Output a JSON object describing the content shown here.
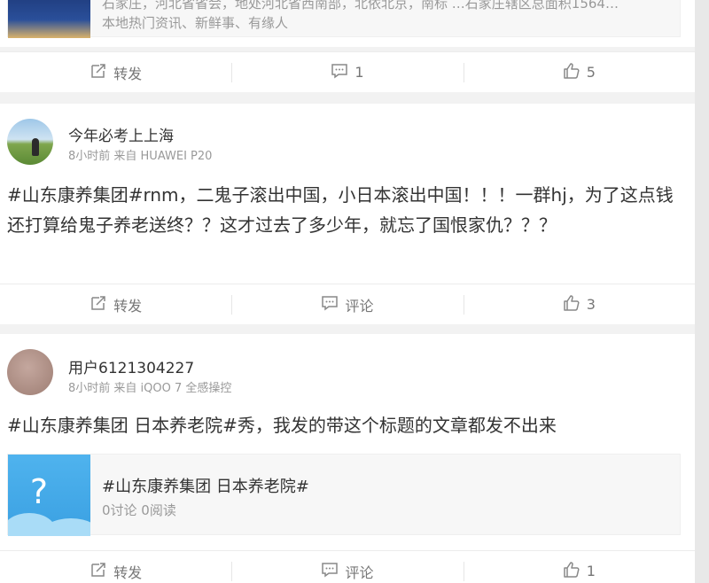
{
  "post0": {
    "excerpt": "石家庄，河北省省会，地处河北省西南部，北依北京，南标 …石家庄辖区总面积1564…",
    "subtitle": "本地热门资讯、新鲜事、有缘人",
    "repost": "转发",
    "comments": "1",
    "likes": "5"
  },
  "post1": {
    "username": "今年必考上上海",
    "meta": "8小时前  来自 HUAWEI P20",
    "text": "#山东康养集团#rnm，二鬼子滚出中国，小日本滚出中国！！！一群hj，为了这点钱还打算给鬼子养老送终？？这才过去了多少年，就忘了国恨家仇？？？",
    "repost": "转发",
    "comment": "评论",
    "likes": "3"
  },
  "post2": {
    "username": "用户6121304227",
    "meta": "8小时前  来自 iQOO 7 全感操控",
    "text": "#山东康养集团 日本养老院#秀，我发的带这个标题的文章都发不出来",
    "link_title": "#山东康养集团 日本养老院#",
    "link_sub": "0讨论 0阅读",
    "thumb_glyph": "?",
    "repost": "转发",
    "comment": "评论",
    "likes": "1"
  },
  "icons": {
    "repost": "repost-icon",
    "comment": "comment-icon",
    "like": "thumbs-up-icon"
  },
  "colors": {
    "background": "#f2f2f2",
    "card": "#ffffff",
    "muted_text": "#999999",
    "thumb_blue": "#3fa9e8"
  }
}
